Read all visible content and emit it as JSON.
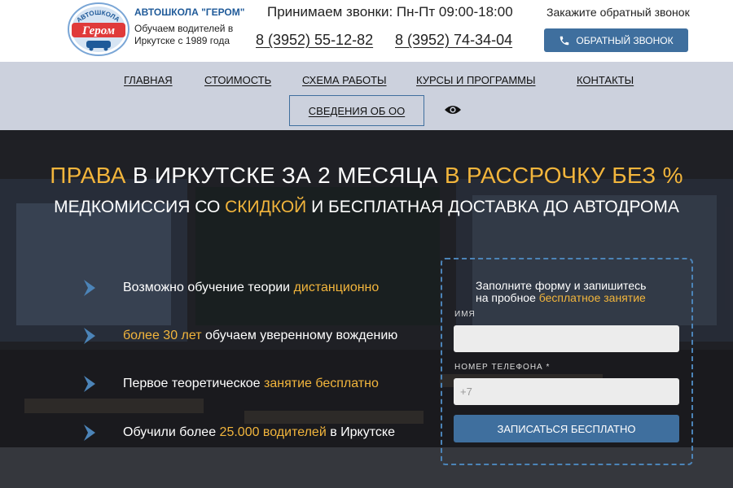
{
  "header": {
    "logo": {
      "arc_text": "АВТОШКОЛА",
      "word": "Гером"
    },
    "brand_name": "АВТОШКОЛА \"ГЕРОМ\"",
    "brand_tagline": "Обучаем водителей в Иркутске с 1989 года",
    "hours": "Принимаем звонки: Пн-Пт 09:00-18:00",
    "phones": [
      "8 (3952) 55-12-82",
      "8 (3952) 74-34-04"
    ],
    "callback_hint": "Закажите обратный звонок",
    "callback_button": "ОБРАТНЫЙ ЗВОНОК",
    "icons": {
      "callback": "phone-icon"
    }
  },
  "nav": {
    "items": [
      "ГЛАВНАЯ",
      "СТОИМОСТЬ",
      "СХЕМА РАБОТЫ",
      "КУРСЫ И ПРОГРАММЫ",
      "КОНТАКТЫ"
    ],
    "info": "СВЕДЕНИЯ ОБ ОО",
    "accessibility_icon": "eye-icon"
  },
  "hero": {
    "headline_1": {
      "a": "ПРАВА",
      "b": " В ИРКУТСКЕ ЗА 2 МЕСЯЦА ",
      "c": "В РАССРОЧКУ БЕЗ %"
    },
    "headline_2": {
      "a": "МЕДКОМИССИЯ СО ",
      "b": "СКИДКОЙ",
      "c": " И БЕСПЛАТНАЯ ДОСТАВКА ДО АВТОДРОМА"
    },
    "features": [
      {
        "pre": "Возможно обучение теории ",
        "hl": "дистанционно",
        "post": ""
      },
      {
        "pre": "",
        "hl": "более 30 лет",
        "post": " обучаем уверенному вождению"
      },
      {
        "pre": "Первое теоретическое ",
        "hl": "занятие бесплатно",
        "post": ""
      },
      {
        "pre": "Обучили более ",
        "hl": "25.000 водителей",
        "post": " в Иркутске"
      }
    ],
    "feature_icon": "chevron-right-icon"
  },
  "form": {
    "title_line1": "Заполните форму и запишитесь",
    "title_pre": "на пробное ",
    "title_hl": "бесплатное занятие",
    "name_label": "ИМЯ",
    "name_value": "",
    "phone_label": "НОМЕР ТЕЛЕФОНА *",
    "phone_placeholder": "+7",
    "submit": "ЗАПИСАТЬСЯ БЕСПЛАТНО"
  },
  "colors": {
    "accent_blue": "#3f6f9e",
    "gold": "#f2b53c",
    "nav_bg": "#ccd1dd",
    "brand_blue": "#1f5a99"
  }
}
